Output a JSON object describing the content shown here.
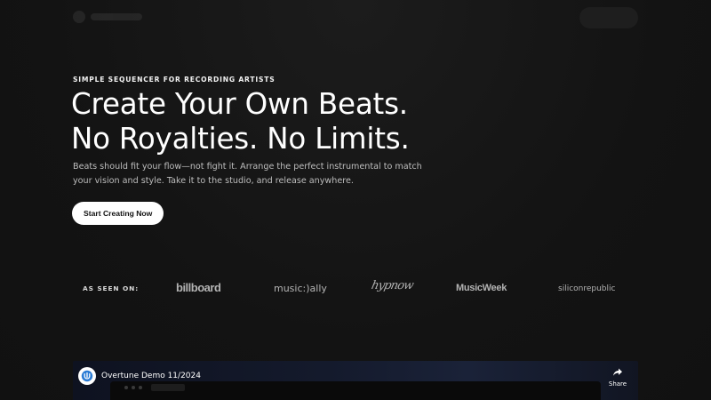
{
  "hero": {
    "eyebrow": "SIMPLE SEQUENCER FOR RECORDING ARTISTS",
    "headline_line1": "Create Your Own Beats.",
    "headline_line2": "No Royalties. No Limits.",
    "sub_line1": "Beats should fit your flow—not fight it. Arrange the perfect instrumental to match",
    "sub_line2": "your vision and style. Take it to the studio, and release anywhere.",
    "cta_label": "Start Creating Now"
  },
  "press": {
    "label": "AS SEEN ON:",
    "logos": [
      "billboard",
      "music:)ally",
      "hypnow",
      "MusicWeek",
      "siliconrepublic"
    ]
  },
  "video": {
    "title": "Overtune Demo 11/2024",
    "share_label": "Share"
  },
  "colors": {
    "background": "#131313",
    "text": "#ffffff",
    "muted_text": "#bdbdbd",
    "logo_gray": "#b3b3b3",
    "button_bg": "#ffffff",
    "button_text": "#111111"
  },
  "icons": {
    "channel": "overtune-channel-icon",
    "share": "share-arrow-icon"
  }
}
